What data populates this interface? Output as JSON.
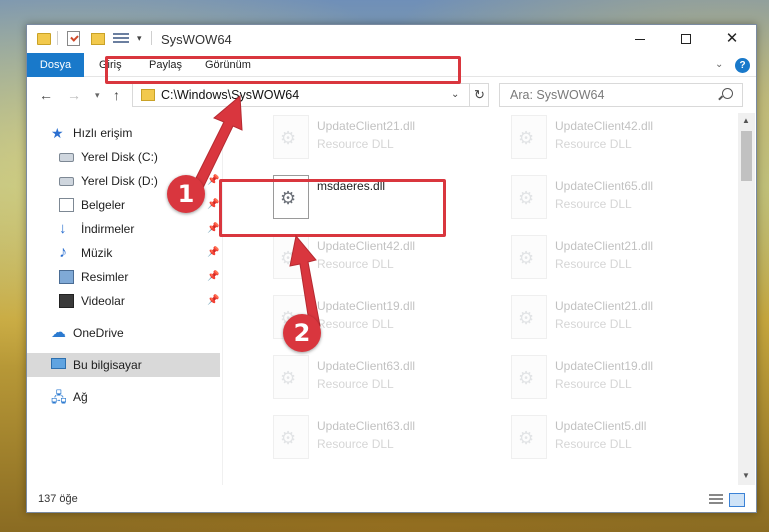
{
  "window": {
    "title": "SysWOW64"
  },
  "ribbon": {
    "tabs": [
      {
        "label": "Dosya"
      },
      {
        "label": "Giriş"
      },
      {
        "label": "Paylaş"
      },
      {
        "label": "Görünüm"
      }
    ]
  },
  "address": {
    "path": "C:\\Windows\\SysWOW64"
  },
  "search": {
    "placeholder": "Ara: SysWOW64"
  },
  "nav_pane": {
    "quick_access": "Hızlı erişim",
    "items": [
      {
        "label": "Yerel Disk (C:)",
        "icon": "drive-icon",
        "pinned": true
      },
      {
        "label": "Yerel Disk (D:)",
        "icon": "drive-icon",
        "pinned": true
      },
      {
        "label": "Belgeler",
        "icon": "documents-icon",
        "pinned": true
      },
      {
        "label": "İndirmeler",
        "icon": "download-icon",
        "pinned": true
      },
      {
        "label": "Müzik",
        "icon": "music-icon",
        "pinned": true
      },
      {
        "label": "Resimler",
        "icon": "pictures-icon",
        "pinned": true
      },
      {
        "label": "Videolar",
        "icon": "videos-icon",
        "pinned": true
      }
    ],
    "onedrive": "OneDrive",
    "this_pc": "Bu bilgisayar",
    "network": "Ağ"
  },
  "files": {
    "left": [
      {
        "name": "UpdateClient21.dll",
        "type": "Resource DLL"
      },
      {
        "name": "msdaeres.dll",
        "type": ""
      },
      {
        "name": "UpdateClient42.dll",
        "type": "Resource DLL"
      },
      {
        "name": "UpdateClient19.dll",
        "type": "Resource DLL"
      },
      {
        "name": "UpdateClient63.dll",
        "type": "Resource DLL"
      },
      {
        "name": "UpdateClient63.dll",
        "type": "Resource DLL"
      }
    ],
    "right": [
      {
        "name": "UpdateClient42.dll",
        "type": "Resource DLL"
      },
      {
        "name": "UpdateClient65.dll",
        "type": "Resource DLL"
      },
      {
        "name": "UpdateClient21.dll",
        "type": "Resource DLL"
      },
      {
        "name": "UpdateClient21.dll",
        "type": "Resource DLL"
      },
      {
        "name": "UpdateClient19.dll",
        "type": "Resource DLL"
      },
      {
        "name": "UpdateClient5.dll",
        "type": "Resource DLL"
      }
    ]
  },
  "status": {
    "item_count": "137 öğe"
  },
  "callouts": {
    "step1": "1",
    "step2": "2"
  },
  "colors": {
    "accent": "#1979ca",
    "callout_red": "#d9363e"
  }
}
